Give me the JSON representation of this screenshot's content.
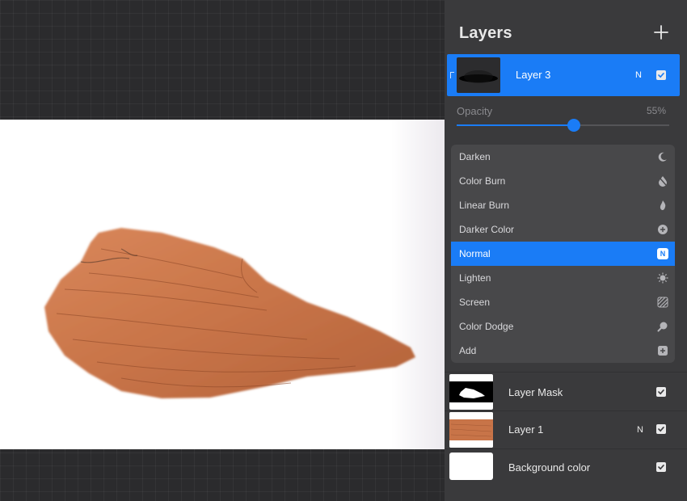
{
  "panel": {
    "title": "Layers",
    "add_icon": "plus-icon"
  },
  "selected_layer": {
    "name": "Layer 3",
    "blend": "N",
    "visible": true
  },
  "opacity": {
    "label": "Opacity",
    "value_text": "55%",
    "value": 0.55
  },
  "blend_modes": [
    {
      "label": "Darken",
      "icon": "moon-icon",
      "active": false
    },
    {
      "label": "Color Burn",
      "icon": "burn-drop-icon",
      "active": false
    },
    {
      "label": "Linear Burn",
      "icon": "flame-icon",
      "active": false
    },
    {
      "label": "Darker Color",
      "icon": "plus-circle-icon",
      "active": false
    },
    {
      "label": "Normal",
      "icon": "n-badge-icon",
      "active": true,
      "badge": "N"
    },
    {
      "label": "Lighten",
      "icon": "sun-icon",
      "active": false
    },
    {
      "label": "Screen",
      "icon": "hatch-icon",
      "active": false
    },
    {
      "label": "Color Dodge",
      "icon": "magnifier-icon",
      "active": false
    },
    {
      "label": "Add",
      "icon": "plus-square-icon",
      "active": false
    }
  ],
  "layers": [
    {
      "name": "Layer Mask",
      "blend": "",
      "visible": true
    },
    {
      "name": "Layer 1",
      "blend": "N",
      "visible": true
    },
    {
      "name": "Background color",
      "blend": "",
      "visible": true
    }
  ],
  "colors": {
    "accent": "#1a7cf6",
    "panel": "#3a3a3c",
    "rock": "#c87448"
  }
}
